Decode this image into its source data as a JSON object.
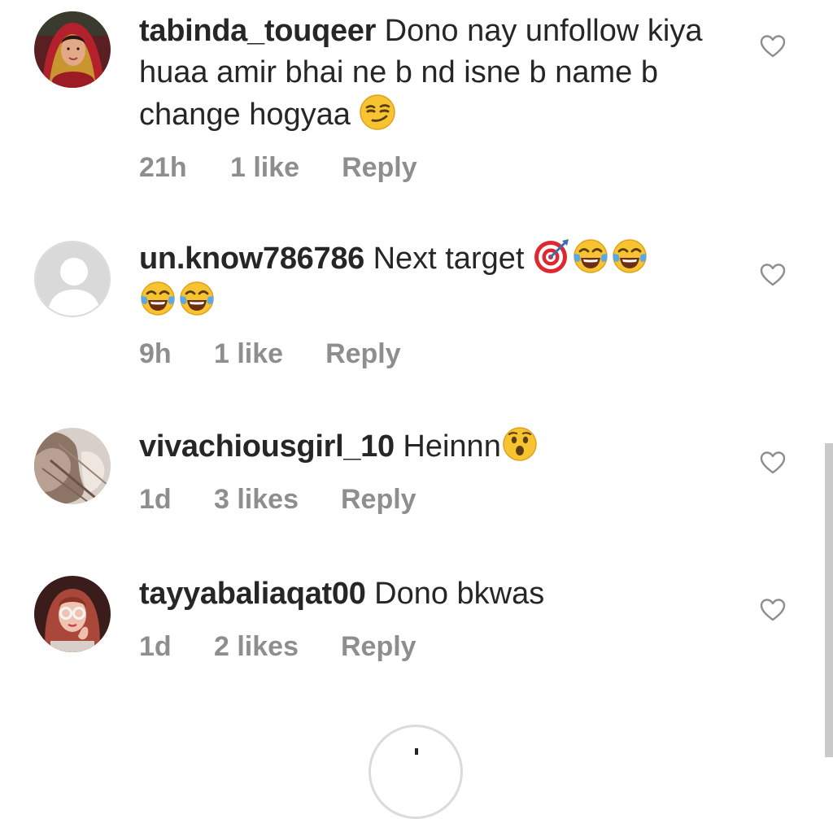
{
  "colors": {
    "text": "#262626",
    "meta": "#8e8e8e",
    "heart_stroke": "#8e8e8e",
    "scrollbar": "#c9c9c9"
  },
  "comments": [
    {
      "username": "tabinda_touqeer",
      "text": "Dono nay unfollow kiya huaa amir bhai ne b nd isne b name b change hogyaa",
      "emojis": [
        "smirking-face-emoji"
      ],
      "time": "21h",
      "likes": "1 like",
      "reply": "Reply",
      "avatar": "bride-photo-avatar",
      "icon": "heart-outline-icon"
    },
    {
      "username": "un.know786786",
      "text": "Next target",
      "emojis": [
        "direct-hit-emoji",
        "tears-of-joy-emoji",
        "tears-of-joy-emoji",
        "tears-of-joy-emoji",
        "tears-of-joy-emoji"
      ],
      "time": "9h",
      "likes": "1 like",
      "reply": "Reply",
      "avatar": "default-silhouette-avatar",
      "icon": "heart-outline-icon"
    },
    {
      "username": "vivachiousgirl_10",
      "text": "Heinnn",
      "emojis": [
        "astonished-face-emoji"
      ],
      "time": "1d",
      "likes": "3 likes",
      "reply": "Reply",
      "avatar": "profile-photo-avatar",
      "icon": "heart-outline-icon"
    },
    {
      "username": "tayyabaliaqat00",
      "text": "Dono bkwas",
      "emojis": [],
      "time": "1d",
      "likes": "2 likes",
      "reply": "Reply",
      "avatar": "girl-with-glasses-avatar",
      "icon": "heart-outline-icon"
    }
  ],
  "load_more_icon": "load-more-icon"
}
